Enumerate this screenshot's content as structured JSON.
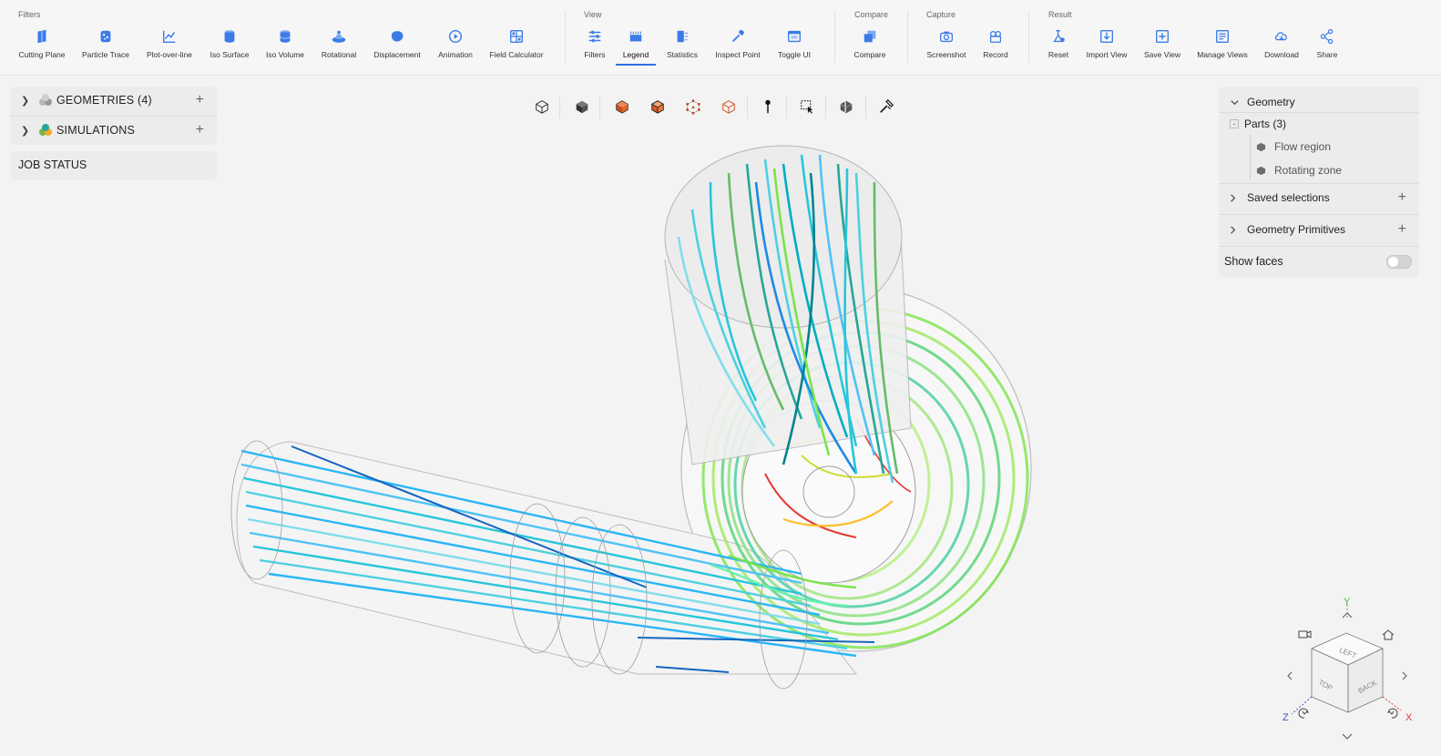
{
  "toolbar": {
    "groups": {
      "filters": "Filters",
      "view": "View",
      "compare": "Compare",
      "capture": "Capture",
      "result": "Result"
    },
    "tools": {
      "cutting_plane": "Cutting Plane",
      "particle_trace": "Particle Trace",
      "plot_over_line": "Plot-over-line",
      "iso_surface": "Iso Surface",
      "iso_volume": "Iso Volume",
      "rotational": "Rotational",
      "displacement": "Displacement",
      "animation": "Animation",
      "field_calculator": "Field Calculator",
      "filters": "Filters",
      "legend": "Legend",
      "statistics": "Statistics",
      "inspect_point": "Inspect Point",
      "toggle_ui": "Toggle UI",
      "compare": "Compare",
      "screenshot": "Screenshot",
      "record": "Record",
      "reset": "Reset",
      "import_view": "Import View",
      "save_view": "Save View",
      "manage_views": "Manage Views",
      "download": "Download",
      "share": "Share"
    },
    "active_tool": "Legend"
  },
  "left_panel": {
    "geometries": "GEOMETRIES (4)",
    "simulations": "SIMULATIONS",
    "job_status": "JOB STATUS"
  },
  "right_panel": {
    "geometry": "Geometry",
    "parts": "Parts (3)",
    "part_items": [
      "Flow region",
      "Rotating zone"
    ],
    "saved_selections": "Saved selections",
    "geometry_primitives": "Geometry Primitives",
    "show_faces": "Show faces",
    "show_faces_on": false
  },
  "nav_cube": {
    "faces": {
      "left": "LEFT",
      "top": "TOP",
      "back": "BACK"
    },
    "axes": {
      "x": "X",
      "y": "Y",
      "z": "Z"
    }
  },
  "colors": {
    "accent": "#2f6fe0",
    "stream_low": "#1e88e5",
    "stream_mid": "#4dd0e1",
    "stream_high": "#7be34a",
    "stream_peak": "#e53935"
  }
}
